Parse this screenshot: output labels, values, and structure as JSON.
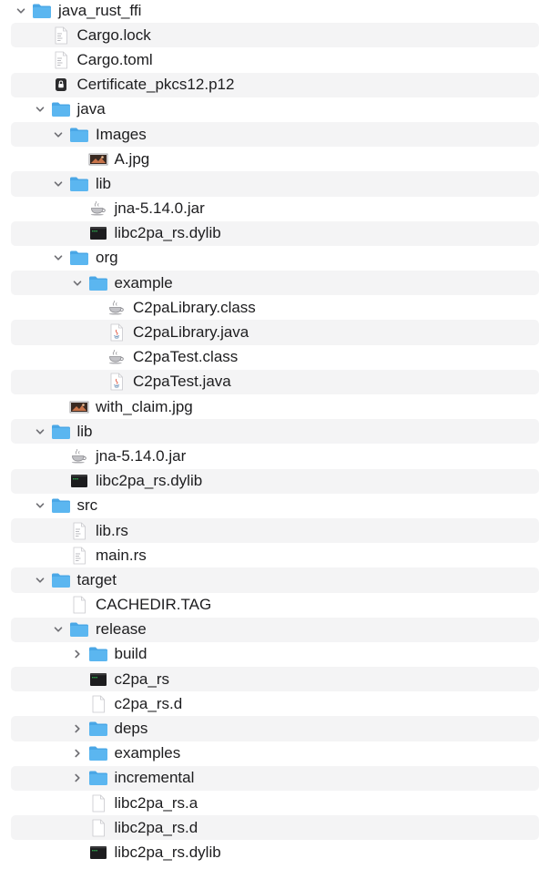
{
  "file_tree": {
    "rows": [
      {
        "name": "java_rust_ffi",
        "type": "folder",
        "depth": 0,
        "expanded": true
      },
      {
        "name": "Cargo.lock",
        "type": "text",
        "depth": 1
      },
      {
        "name": "Cargo.toml",
        "type": "text",
        "depth": 1
      },
      {
        "name": "Certificate_pkcs12.p12",
        "type": "certificate",
        "depth": 1
      },
      {
        "name": "java",
        "type": "folder",
        "depth": 1,
        "expanded": true
      },
      {
        "name": "Images",
        "type": "folder",
        "depth": 2,
        "expanded": true
      },
      {
        "name": "A.jpg",
        "type": "image",
        "depth": 3
      },
      {
        "name": "lib",
        "type": "folder",
        "depth": 2,
        "expanded": true
      },
      {
        "name": "jna-5.14.0.jar",
        "type": "jar",
        "depth": 3
      },
      {
        "name": "libc2pa_rs.dylib",
        "type": "exec",
        "depth": 3
      },
      {
        "name": "org",
        "type": "folder",
        "depth": 2,
        "expanded": true
      },
      {
        "name": "example",
        "type": "folder",
        "depth": 3,
        "expanded": true
      },
      {
        "name": "C2paLibrary.class",
        "type": "jar",
        "depth": 4
      },
      {
        "name": "C2paLibrary.java",
        "type": "java",
        "depth": 4
      },
      {
        "name": "C2paTest.class",
        "type": "jar",
        "depth": 4
      },
      {
        "name": "C2paTest.java",
        "type": "java",
        "depth": 4
      },
      {
        "name": "with_claim.jpg",
        "type": "image",
        "depth": 2
      },
      {
        "name": "lib",
        "type": "folder",
        "depth": 1,
        "expanded": true
      },
      {
        "name": "jna-5.14.0.jar",
        "type": "jar",
        "depth": 2
      },
      {
        "name": "libc2pa_rs.dylib",
        "type": "exec",
        "depth": 2
      },
      {
        "name": "src",
        "type": "folder",
        "depth": 1,
        "expanded": true
      },
      {
        "name": "lib.rs",
        "type": "text",
        "depth": 2
      },
      {
        "name": "main.rs",
        "type": "text",
        "depth": 2
      },
      {
        "name": "target",
        "type": "folder",
        "depth": 1,
        "expanded": true
      },
      {
        "name": "CACHEDIR.TAG",
        "type": "blank",
        "depth": 2
      },
      {
        "name": "release",
        "type": "folder",
        "depth": 2,
        "expanded": true
      },
      {
        "name": "build",
        "type": "folder",
        "depth": 3,
        "expanded": false
      },
      {
        "name": "c2pa_rs",
        "type": "exec",
        "depth": 3
      },
      {
        "name": "c2pa_rs.d",
        "type": "blank",
        "depth": 3
      },
      {
        "name": "deps",
        "type": "folder",
        "depth": 3,
        "expanded": false
      },
      {
        "name": "examples",
        "type": "folder",
        "depth": 3,
        "expanded": false
      },
      {
        "name": "incremental",
        "type": "folder",
        "depth": 3,
        "expanded": false
      },
      {
        "name": "libc2pa_rs.a",
        "type": "blank",
        "depth": 3
      },
      {
        "name": "libc2pa_rs.d",
        "type": "blank",
        "depth": 3
      },
      {
        "name": "libc2pa_rs.dylib",
        "type": "exec",
        "depth": 3
      }
    ]
  },
  "colors": {
    "folder": "#5bb6f0",
    "folder_tab": "#4aa7e6",
    "stripe": "#f4f4f5",
    "text": "#1d1d1f",
    "disclosure": "#6e6e73"
  }
}
